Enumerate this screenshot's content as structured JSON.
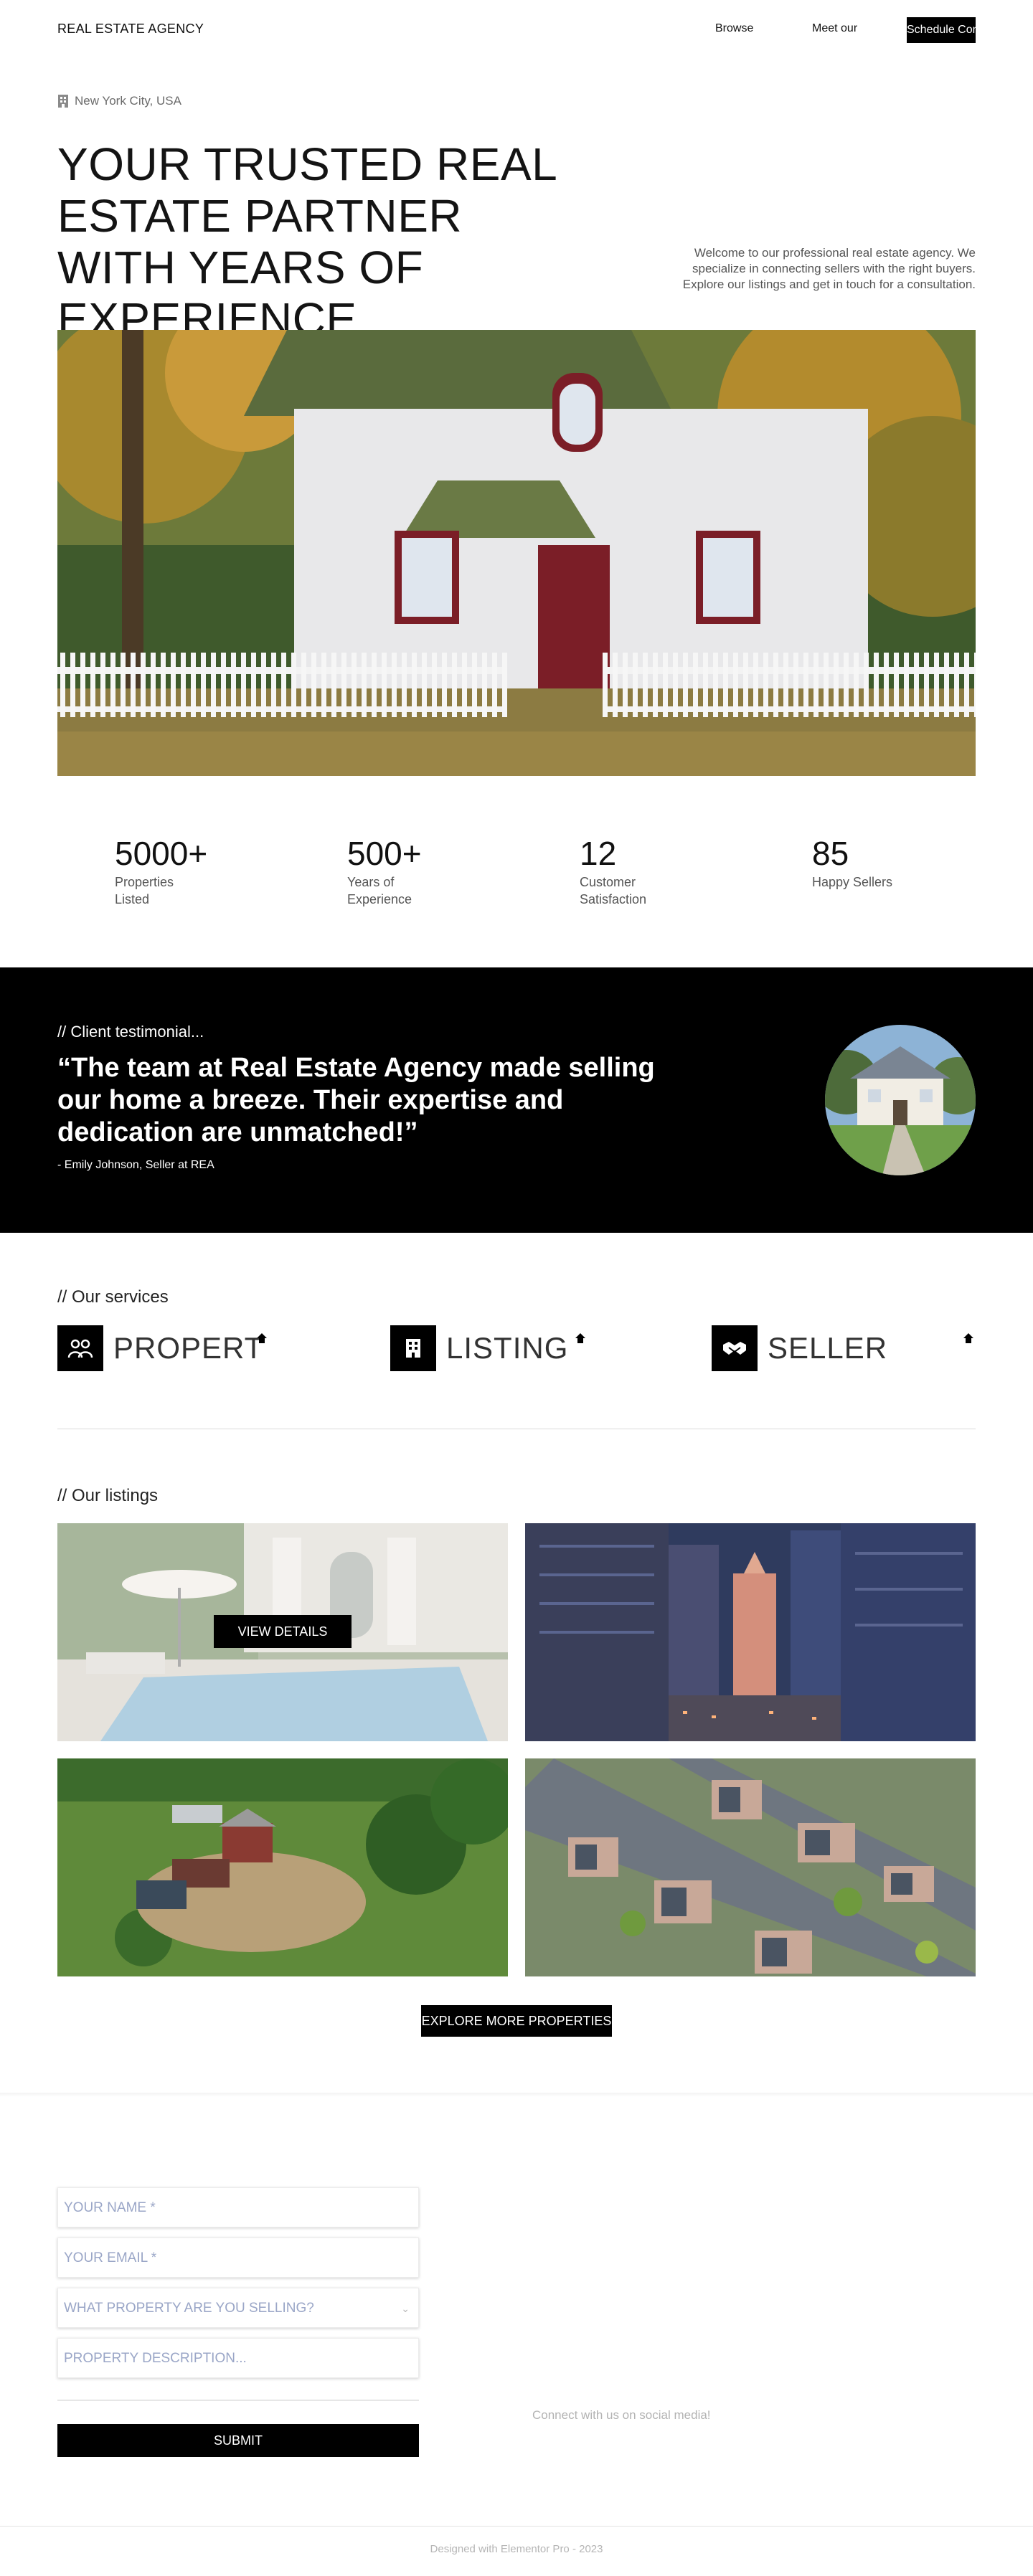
{
  "header": {
    "brand": "REAL ESTATE AGENCY",
    "nav": [
      "Browse",
      "Meet our"
    ],
    "cta": "Schedule Consultation"
  },
  "hero": {
    "location": "New York City, USA",
    "title": "YOUR TRUSTED REAL ESTATE PARTNER WITH YEARS OF EXPERIENCE.",
    "intro": "Welcome to our professional real estate agency. We specialize in connecting sellers with the right buyers. Explore our listings and get in touch for a consultation."
  },
  "stats": [
    {
      "value": "5000+",
      "label": "Properties Listed"
    },
    {
      "value": "500+",
      "label": "Years of Experience"
    },
    {
      "value": "12",
      "label": "Customer Satisfaction"
    },
    {
      "value": "85",
      "label": "Happy Sellers"
    }
  ],
  "testimonial": {
    "kicker": "// Client testimonial...",
    "quote": "“The team at Real Estate Agency made selling our home a breeze. Their expertise and dedication are unmatched!”",
    "author": "- Emily Johnson, Seller at REA"
  },
  "services": {
    "kicker": "// Our services",
    "items": [
      {
        "label": "PROPERT",
        "icon": "handshake-people-icon"
      },
      {
        "label": "LISTING",
        "icon": "building-icon"
      },
      {
        "label": "SELLER",
        "icon": "handshake-icon"
      }
    ]
  },
  "listings": {
    "kicker": "// Our listings",
    "view_details": "VIEW DETAILS",
    "explore": "EXPLORE MORE PROPERTIES"
  },
  "form": {
    "name_placeholder": "YOUR NAME *",
    "email_placeholder": "YOUR EMAIL *",
    "property_placeholder": "WHAT PROPERTY ARE YOU SELLING?",
    "description_placeholder": "PROPERTY DESCRIPTION...",
    "submit": "SUBMIT",
    "social": "Connect with us on social media!"
  },
  "footer": {
    "credit": "Designed with Elementor Pro - 2023"
  }
}
